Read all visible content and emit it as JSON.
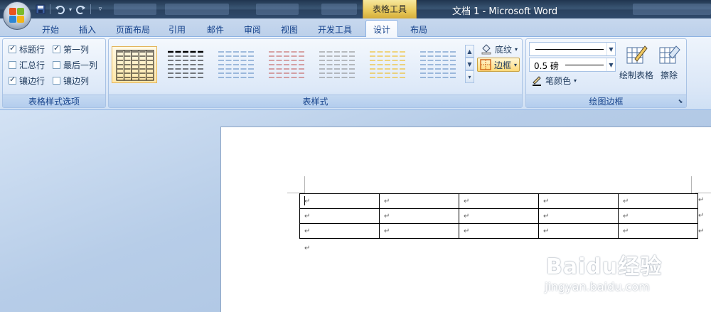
{
  "title_bar": {
    "window_title": "文档 1 - Microsoft Word",
    "context_tab_header": "表格工具",
    "quick_access": [
      "save-icon",
      "undo-icon",
      "redo-icon",
      "customize-icon"
    ]
  },
  "tabs": [
    {
      "label": "开始",
      "active": false
    },
    {
      "label": "插入",
      "active": false
    },
    {
      "label": "页面布局",
      "active": false
    },
    {
      "label": "引用",
      "active": false
    },
    {
      "label": "邮件",
      "active": false
    },
    {
      "label": "审阅",
      "active": false
    },
    {
      "label": "视图",
      "active": false
    },
    {
      "label": "开发工具",
      "active": false
    },
    {
      "label": "设计",
      "active": true
    },
    {
      "label": "布局",
      "active": false
    }
  ],
  "table_style_options": {
    "label": "表格样式选项",
    "checkboxes": [
      {
        "label": "标题行",
        "checked": true
      },
      {
        "label": "第一列",
        "checked": true
      },
      {
        "label": "汇总行",
        "checked": false
      },
      {
        "label": "最后一列",
        "checked": false
      },
      {
        "label": "镶边行",
        "checked": true
      },
      {
        "label": "镶边列",
        "checked": false
      }
    ]
  },
  "table_styles": {
    "label": "表样式",
    "thumbnails": [
      {
        "line_color": "#000000",
        "selected": true
      },
      {
        "line_color": "#000000",
        "selected": false
      },
      {
        "line_color": "#4f81bd",
        "selected": false
      },
      {
        "line_color": "#c0504d",
        "selected": false
      },
      {
        "line_color": "#808080",
        "selected": false
      },
      {
        "line_color": "#f0b400",
        "selected": false
      },
      {
        "line_color": "#4f81bd",
        "selected": false
      }
    ],
    "shading_label": "底纹",
    "borders_label": "边框"
  },
  "draw_borders": {
    "label": "绘图边框",
    "line_weight": "0.5 磅",
    "pen_color_label": "笔颜色",
    "draw_table_label": "绘制表格",
    "eraser_label": "擦除"
  },
  "document": {
    "rows": 3,
    "cols": 5,
    "para_mark": "↵"
  },
  "watermark": {
    "main": "Baidu经验",
    "sub": "jingyan.baidu.com"
  },
  "colors": {
    "accent": "#15428b",
    "context_tab": "#e9c95a"
  }
}
